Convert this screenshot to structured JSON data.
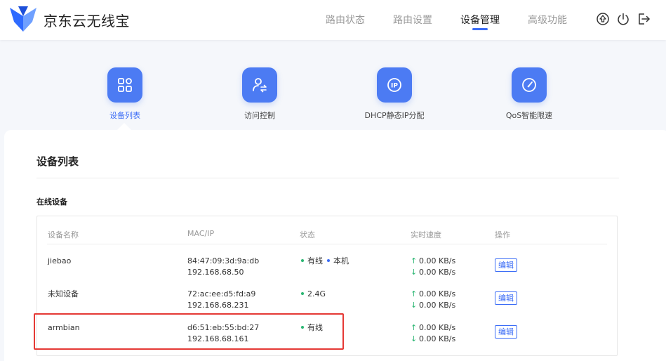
{
  "header": {
    "brand": "京东云无线宝",
    "nav": [
      {
        "label": "路由状态"
      },
      {
        "label": "路由设置"
      },
      {
        "label": "设备管理"
      },
      {
        "label": "高级功能"
      }
    ],
    "active_nav": "设备管理"
  },
  "features": [
    {
      "label": "设备列表",
      "icon": "grid-icon"
    },
    {
      "label": "访问控制",
      "icon": "user-switch-icon"
    },
    {
      "label": "DHCP静态IP分配",
      "icon": "ip-icon"
    },
    {
      "label": "QoS智能限速",
      "icon": "speedometer-icon"
    }
  ],
  "card": {
    "title": "设备列表",
    "section": "在线设备"
  },
  "table": {
    "headers": [
      "设备名称",
      "MAC/IP",
      "状态",
      "实时速度",
      "操作"
    ],
    "rows": [
      {
        "name": "jiebao",
        "mac": "84:47:09:3d:9a:db",
        "ip": "192.168.68.50",
        "status": "有线",
        "status2": "本机",
        "up": "0.00 KB/s",
        "down": "0.00 KB/s",
        "action": "编辑"
      },
      {
        "name": "未知设备",
        "mac": "72:ac:ee:d5:fd:a9",
        "ip": "192.168.68.231",
        "status": "2.4G",
        "up": "0.00 KB/s",
        "down": "0.00 KB/s",
        "action": "编辑"
      },
      {
        "name": "armbian",
        "mac": "d6:51:eb:55:bd:27",
        "ip": "192.168.68.161",
        "status": "有线",
        "up": "0.00 KB/s",
        "down": "0.00 KB/s",
        "action": "编辑"
      }
    ]
  },
  "colors": {
    "accent": "#3b6cf6",
    "online": "#2bb673",
    "highlight": "#e53935"
  }
}
